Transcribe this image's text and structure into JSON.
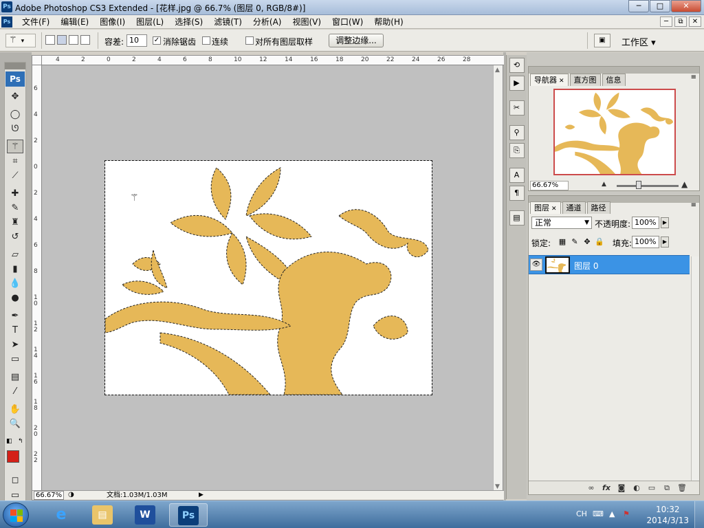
{
  "window": {
    "title": "Adobe Photoshop CS3 Extended - [花样.jpg @ 66.7% (图层 0, RGB/8#)]",
    "app_icon": "Ps",
    "buttons": {
      "minimize": "─",
      "maximize": "□",
      "close": "✕"
    }
  },
  "menubar": {
    "logo": "Ps",
    "items": [
      "文件(F)",
      "编辑(E)",
      "图像(I)",
      "图层(L)",
      "选择(S)",
      "滤镜(T)",
      "分析(A)",
      "视图(V)",
      "窗口(W)",
      "帮助(H)"
    ],
    "doc_buttons": [
      "─",
      "⧉",
      "✕"
    ]
  },
  "options_bar": {
    "tool_preset_icon": "magic-wand-icon",
    "tolerance_label": "容差:",
    "tolerance_value": "10",
    "antialias_label": "消除锯齿",
    "antialias_checked": true,
    "contiguous_label": "连续",
    "contiguous_checked": false,
    "sample_all_label": "对所有图层取样",
    "sample_all_checked": false,
    "refine_edge_label": "调整边缘...",
    "workspace_label": "工作区 ▾"
  },
  "rulers": {
    "top": [
      "4",
      "2",
      "0",
      "2",
      "4",
      "6",
      "8",
      "10",
      "12",
      "14",
      "16",
      "18",
      "20",
      "22",
      "24",
      "26",
      "28"
    ],
    "left": [
      "6",
      "4",
      "2",
      "0",
      "2",
      "4",
      "6",
      "8",
      "10",
      "12",
      "14",
      "16",
      "18",
      "20",
      "22"
    ]
  },
  "status_bar": {
    "zoom": "66.67%",
    "doc_info": "文档:1.03M/1.03M",
    "arrow": "▶"
  },
  "toolbox": {
    "badge": "Ps",
    "tools": [
      {
        "name": "move-tool-icon",
        "glyph": "✥"
      },
      {
        "name": "ellipse-marquee-tool-icon",
        "glyph": "◯"
      },
      {
        "name": "lasso-tool-icon",
        "glyph": "ᘎ"
      },
      {
        "name": "magic-wand-tool-icon",
        "glyph": "⚚",
        "active": true
      },
      {
        "name": "crop-tool-icon",
        "glyph": "⌗"
      },
      {
        "name": "slice-tool-icon",
        "glyph": "⟋"
      },
      {
        "name": "healing-brush-tool-icon",
        "glyph": "✚"
      },
      {
        "name": "brush-tool-icon",
        "glyph": "✎"
      },
      {
        "name": "clone-stamp-tool-icon",
        "glyph": "♜"
      },
      {
        "name": "history-brush-tool-icon",
        "glyph": "↺"
      },
      {
        "name": "eraser-tool-icon",
        "glyph": "▱"
      },
      {
        "name": "gradient-tool-icon",
        "glyph": "▮"
      },
      {
        "name": "blur-tool-icon",
        "glyph": "💧"
      },
      {
        "name": "dodge-tool-icon",
        "glyph": "●"
      },
      {
        "name": "pen-tool-icon",
        "glyph": "✒"
      },
      {
        "name": "type-tool-icon",
        "glyph": "T"
      },
      {
        "name": "path-selection-tool-icon",
        "glyph": "➤"
      },
      {
        "name": "rectangle-tool-icon",
        "glyph": "▭"
      },
      {
        "name": "notes-tool-icon",
        "glyph": "▤"
      },
      {
        "name": "eyedropper-tool-icon",
        "glyph": "⁄"
      },
      {
        "name": "hand-tool-icon",
        "glyph": "✋"
      },
      {
        "name": "zoom-tool-icon",
        "glyph": "🔍"
      }
    ],
    "foreground_color": "#d42018",
    "background_color": "#ffffff",
    "quick_mask_icon": "◻",
    "screen_mode_icon": "▭"
  },
  "navigator_panel": {
    "tabs": [
      "导航器",
      "直方图",
      "信息"
    ],
    "active_tab": "导航器",
    "zoom": "66.67%",
    "view_box_color": "#cc4a4a"
  },
  "layers_panel": {
    "tabs": [
      "图层",
      "通道",
      "路径"
    ],
    "active_tab": "图层",
    "blend_mode": "正常",
    "opacity_label": "不透明度:",
    "opacity_value": "100%",
    "lock_label": "锁定:",
    "fill_label": "填充:",
    "fill_value": "100%",
    "layers": [
      {
        "name": "图层 0",
        "visible": true,
        "selected": true
      }
    ],
    "footer_icons": [
      "link-layers-icon",
      "fx-icon",
      "mask-icon",
      "adjustment-icon",
      "group-icon",
      "new-layer-icon",
      "trash-icon"
    ]
  },
  "panel_strip_icons": [
    "history-icon",
    "actions-icon",
    "tool-presets-icon",
    "brushes-icon",
    "clone-source-icon",
    "character-icon",
    "paragraph-icon",
    "layer-comps-icon"
  ],
  "image": {
    "fill_color": "#e6b858",
    "background": "#ffffff"
  },
  "taskbar": {
    "apps": [
      "ie-icon",
      "explorer-icon",
      "word-icon",
      "photoshop-icon"
    ],
    "active_app": "photoshop-icon",
    "input_lang": "CH",
    "time": "10:32",
    "date": "2014/3/13"
  }
}
